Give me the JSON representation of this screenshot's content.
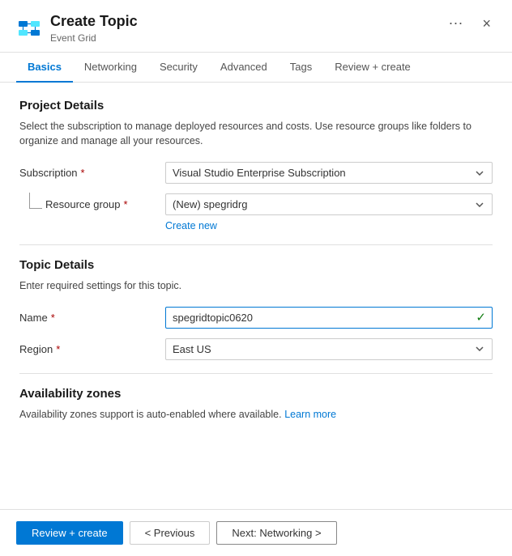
{
  "header": {
    "title": "Create Topic",
    "subtitle": "Event Grid",
    "ellipsis": "···",
    "close": "×"
  },
  "tabs": [
    {
      "id": "basics",
      "label": "Basics",
      "active": true
    },
    {
      "id": "networking",
      "label": "Networking",
      "active": false
    },
    {
      "id": "security",
      "label": "Security",
      "active": false
    },
    {
      "id": "advanced",
      "label": "Advanced",
      "active": false
    },
    {
      "id": "tags",
      "label": "Tags",
      "active": false
    },
    {
      "id": "review-create",
      "label": "Review + create",
      "active": false
    }
  ],
  "project_details": {
    "section_title": "Project Details",
    "section_desc": "Select the subscription to manage deployed resources and costs. Use resource groups like folders to organize and manage all your resources.",
    "subscription_label": "Subscription",
    "subscription_value": "Visual Studio Enterprise Subscription",
    "resource_group_label": "Resource group",
    "resource_group_value": "(New) spegridrg",
    "create_new_link": "Create new"
  },
  "topic_details": {
    "section_title": "Topic Details",
    "section_desc": "Enter required settings for this topic.",
    "name_label": "Name",
    "name_value": "spegridtopic0620",
    "region_label": "Region",
    "region_value": "East US"
  },
  "availability_zones": {
    "section_title": "Availability zones",
    "desc": "Availability zones support is auto-enabled where available.",
    "learn_more": "Learn more"
  },
  "footer": {
    "review_create": "Review + create",
    "previous": "< Previous",
    "next": "Next: Networking >"
  }
}
